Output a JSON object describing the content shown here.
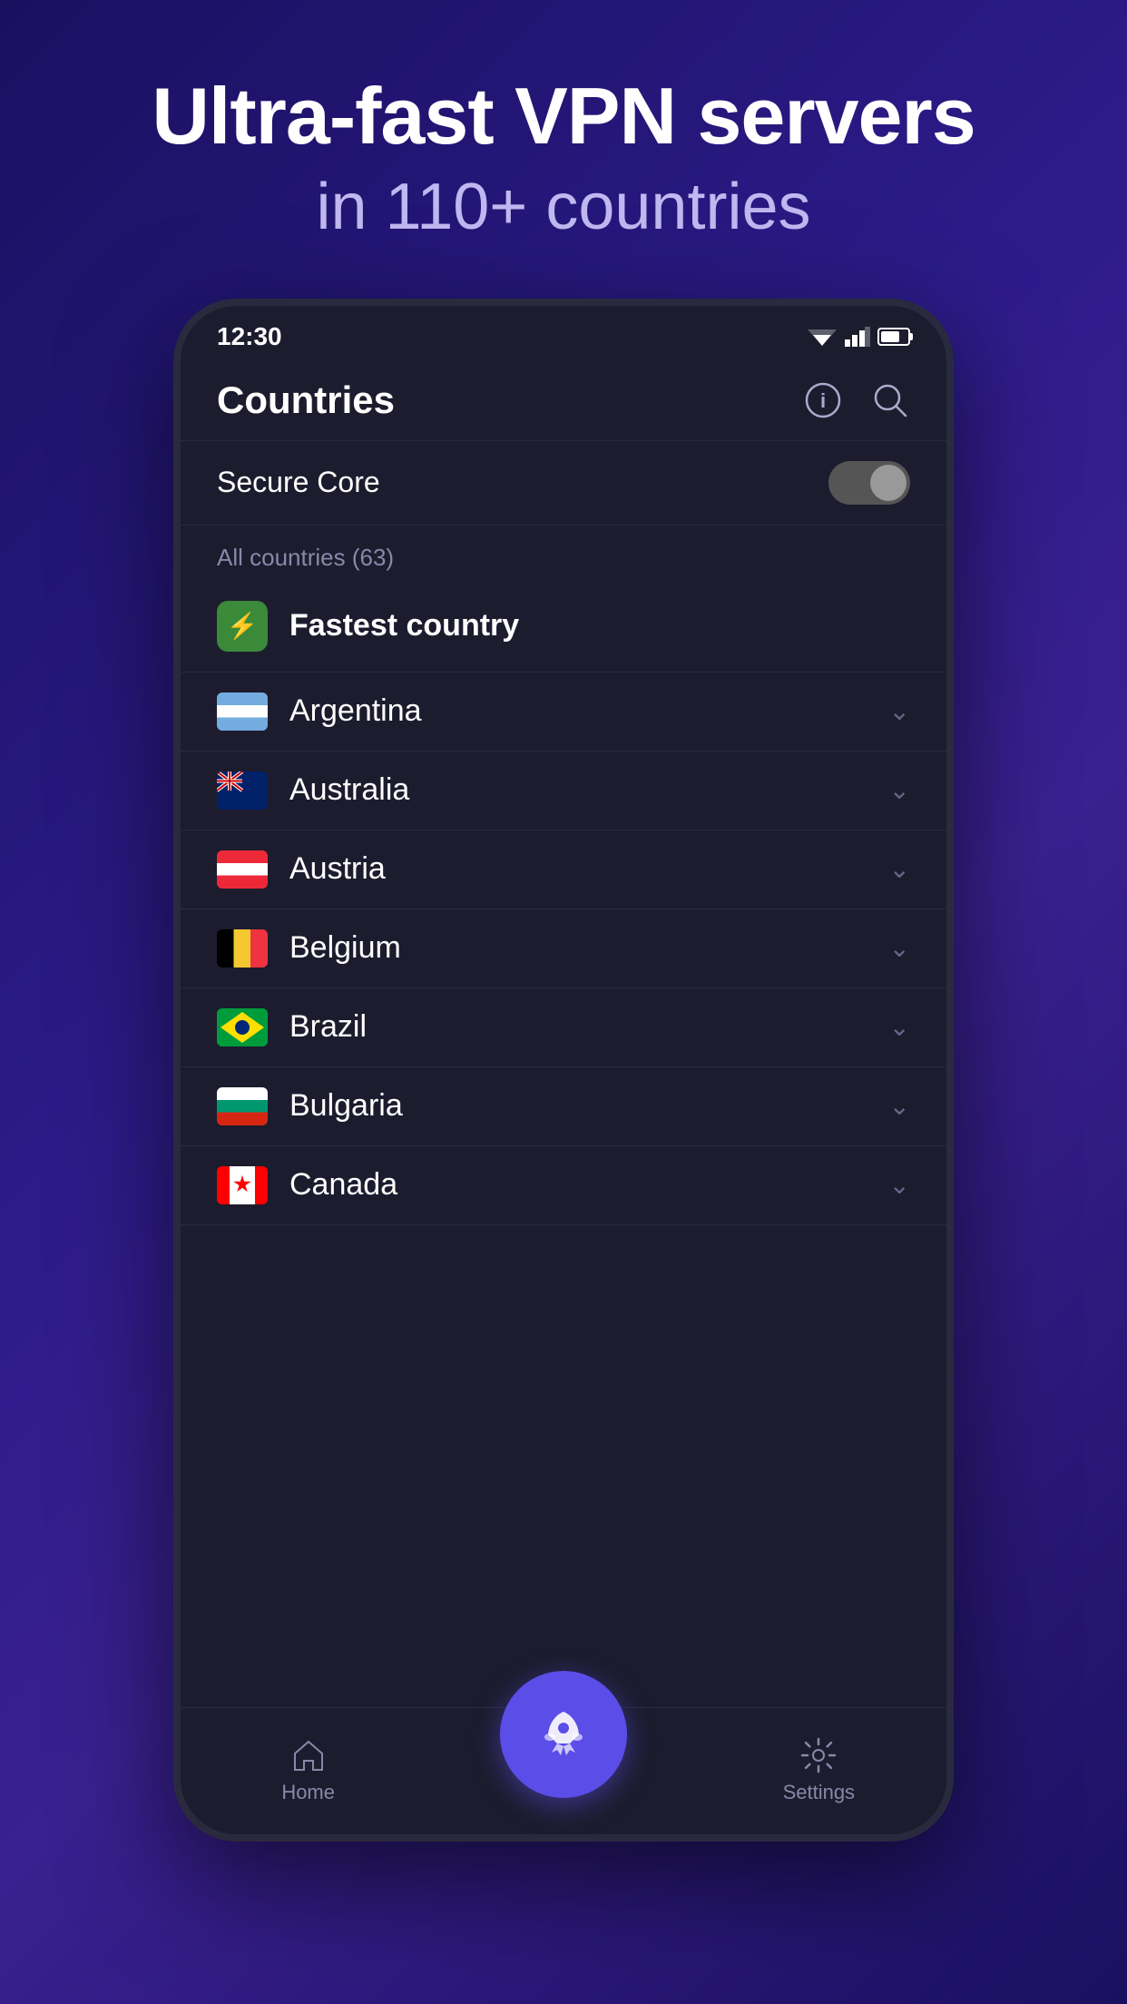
{
  "background": {
    "gradient_start": "#1a1060",
    "gradient_end": "#3a2090"
  },
  "header": {
    "title_line1": "Ultra-fast VPN servers",
    "title_line2": "in 110+ countries"
  },
  "status_bar": {
    "time": "12:30"
  },
  "app": {
    "title": "Countries",
    "info_icon": "ℹ",
    "search_icon": "🔍"
  },
  "secure_core": {
    "label": "Secure Core",
    "enabled": false
  },
  "countries_section": {
    "label": "All countries (63)",
    "fastest": {
      "label": "Fastest country",
      "icon": "⚡"
    },
    "list": [
      {
        "name": "Argentina",
        "flag_emoji": "🇦🇷",
        "flag_class": "flag-argentina"
      },
      {
        "name": "Australia",
        "flag_emoji": "🇦🇺",
        "flag_class": "flag-australia"
      },
      {
        "name": "Austria",
        "flag_emoji": "🇦🇹",
        "flag_class": "flag-austria"
      },
      {
        "name": "Belgium",
        "flag_emoji": "🇧🇪",
        "flag_class": "flag-belgium"
      },
      {
        "name": "Brazil",
        "flag_emoji": "🇧🇷",
        "flag_class": "flag-brazil"
      },
      {
        "name": "Bulgaria",
        "flag_emoji": "🇧🇬",
        "flag_class": "flag-bulgaria"
      },
      {
        "name": "Canada",
        "flag_emoji": "🇨🇦",
        "flag_class": "flag-canada"
      }
    ]
  },
  "bottom_nav": {
    "home_label": "Home",
    "settings_label": "Settings",
    "connect_icon": "🚀"
  }
}
